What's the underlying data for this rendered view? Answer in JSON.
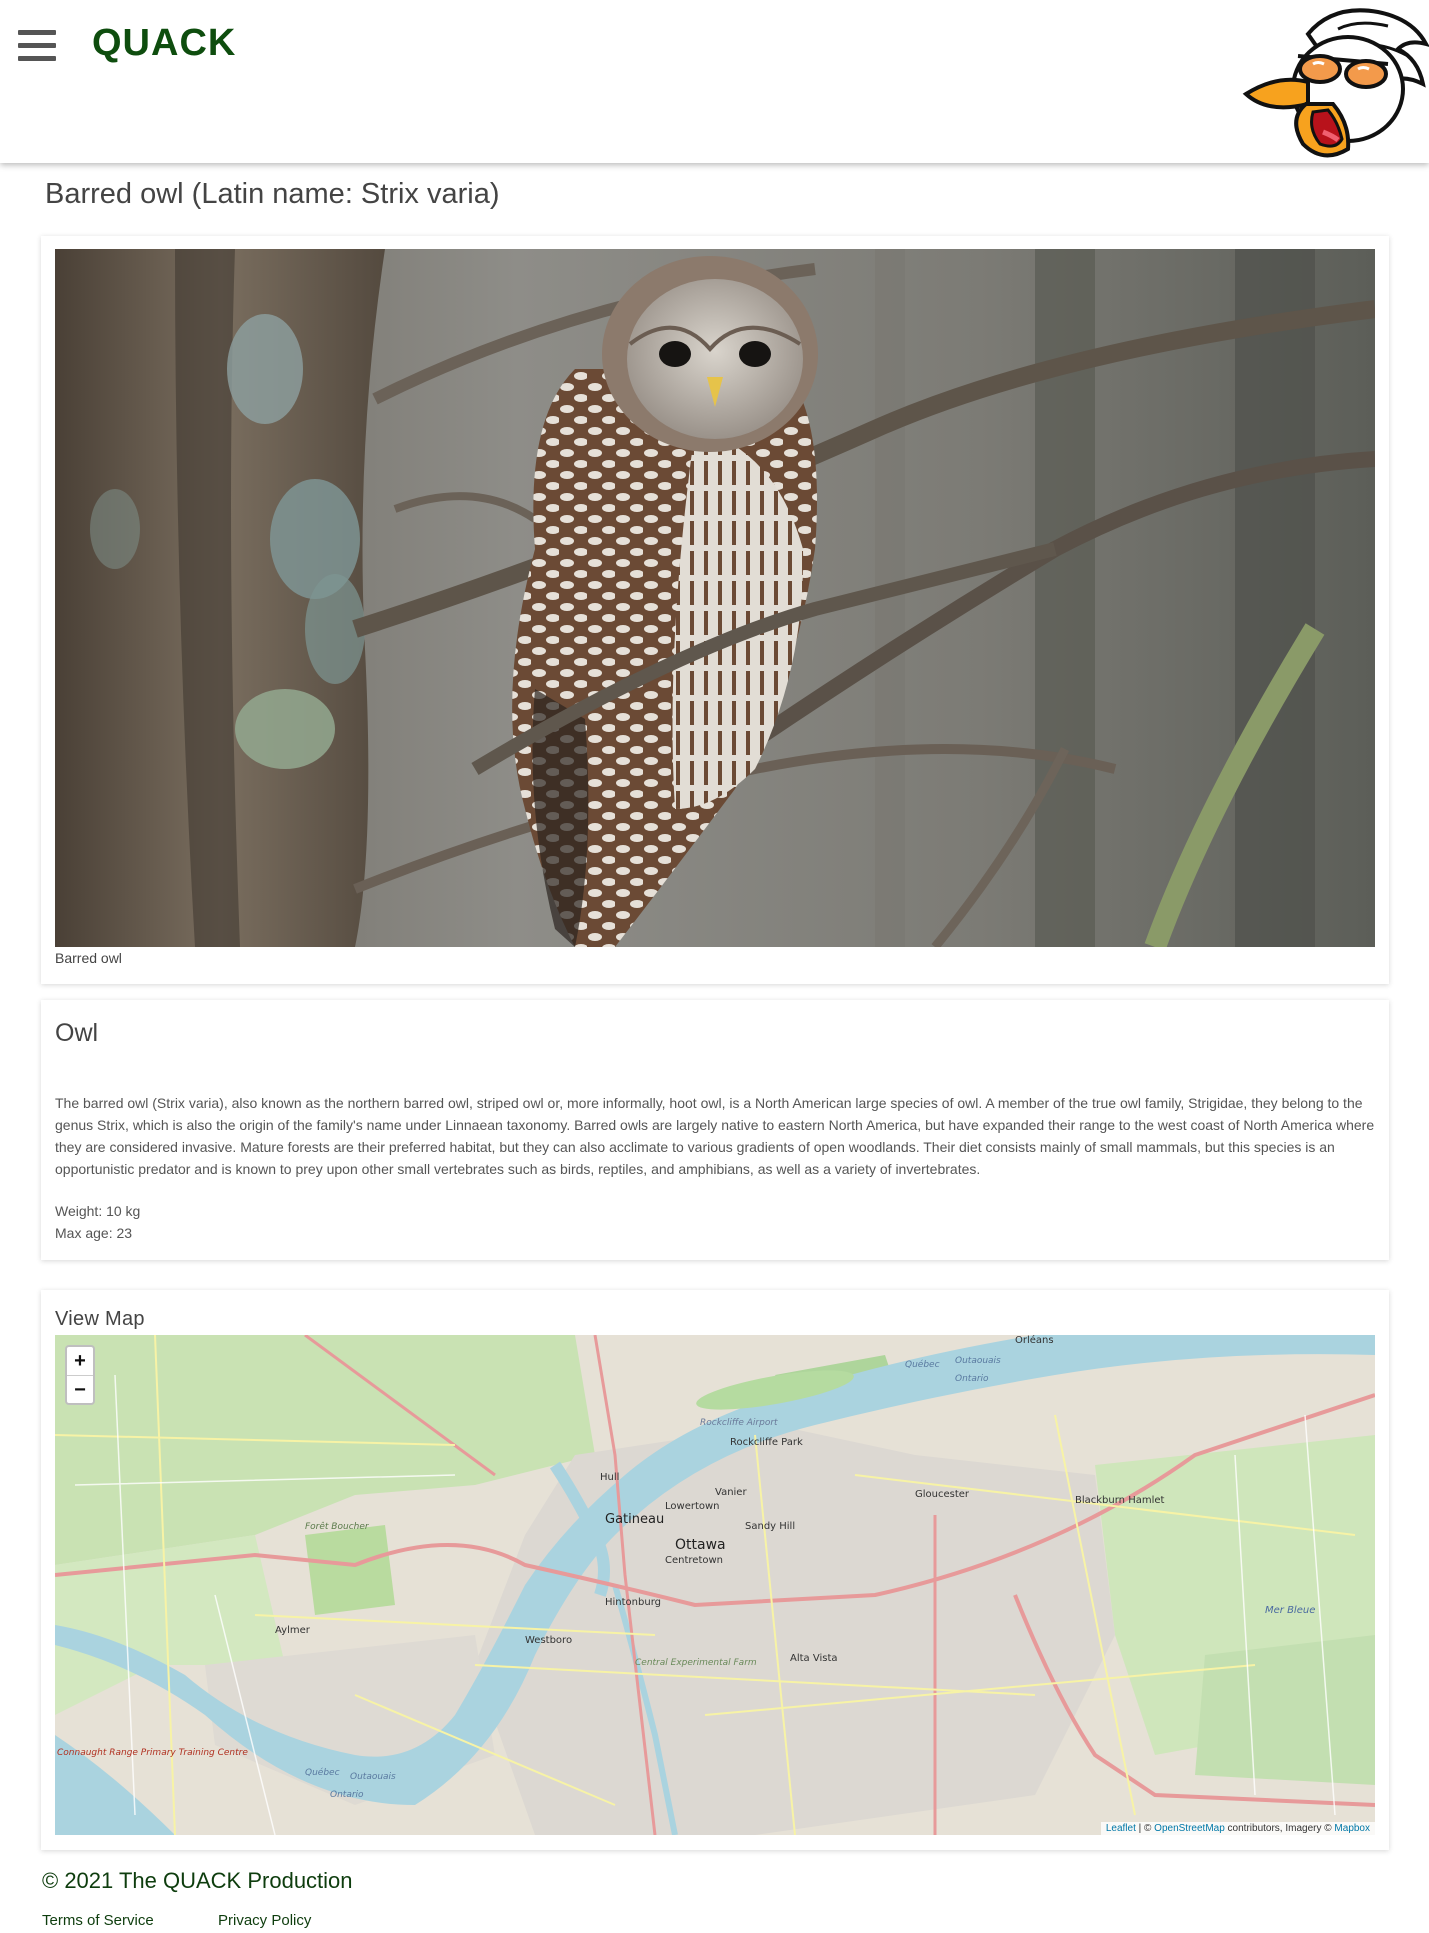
{
  "header": {
    "brand": "QUACK",
    "menu_icon": "hamburger-menu-icon",
    "logo": "duck-mascot-logo"
  },
  "page": {
    "title": "Barred owl (Latin name: Strix varia)"
  },
  "photo": {
    "caption": "Barred owl"
  },
  "info": {
    "title": "Owl",
    "description": "The barred owl (Strix varia), also known as the northern barred owl, striped owl or, more informally, hoot owl, is a North American large species of owl. A member of the true owl family, Strigidae, they belong to the genus Strix, which is also the origin of the family's name under Linnaean taxonomy. Barred owls are largely native to eastern North America, but have expanded their range to the west coast of North America where they are considered invasive. Mature forests are their preferred habitat, but they can also acclimate to various gradients of open woodlands. Their diet consists mainly of small mammals, but this species is an opportunistic predator and is known to prey upon other small vertebrates such as birds, reptiles, and amphibians, as well as a variety of invertebrates.",
    "weight": "Weight: 10 kg",
    "max_age": "Max age: 23"
  },
  "map": {
    "title": "View Map",
    "zoom_in": "+",
    "zoom_out": "−",
    "places": {
      "orleans": "Orléans",
      "rockcliffe_park": "Rockcliffe Park",
      "rockcliffe_airport": "Rockcliffe Airport",
      "hull": "Hull",
      "vanier": "Vanier",
      "lowertown": "Lowertown",
      "gatineau": "Gatineau",
      "gloucester": "Gloucester",
      "blackburn": "Blackburn Hamlet",
      "sandy_hill": "Sandy Hill",
      "ottawa": "Ottawa",
      "centretown": "Centretown",
      "foret": "Forêt Boucher",
      "hintonburg": "Hintonburg",
      "aylmer": "Aylmer",
      "westboro": "Westboro",
      "alta_vista": "Alta Vista",
      "experimental_farm": "Central Experimental Farm",
      "mer_bleue": "Mer Bleue",
      "quebec_1": "Québec",
      "outaouais_1": "Outaouais",
      "ontario_1": "Ontario",
      "quebec_2": "Québec",
      "outaouais_2": "Outaouais",
      "ontario_2": "Ontario",
      "connaught": "Connaught Range Primary Training Centre"
    },
    "attribution_leaflet": "Leaflet",
    "attribution_osm": "OpenStreetMap",
    "attribution_mid": " contributors, Imagery © ",
    "attribution_mapbox": "Mapbox",
    "attribution_sep": " | © "
  },
  "footer": {
    "copyright": "© 2021 The QUACK Production",
    "terms": "Terms of Service",
    "privacy": "Privacy Policy"
  },
  "colors": {
    "brand": "#0e4d0e",
    "map_water": "#aad3df",
    "map_park": "#c8e6b4",
    "map_urban": "#e0ddd6"
  }
}
